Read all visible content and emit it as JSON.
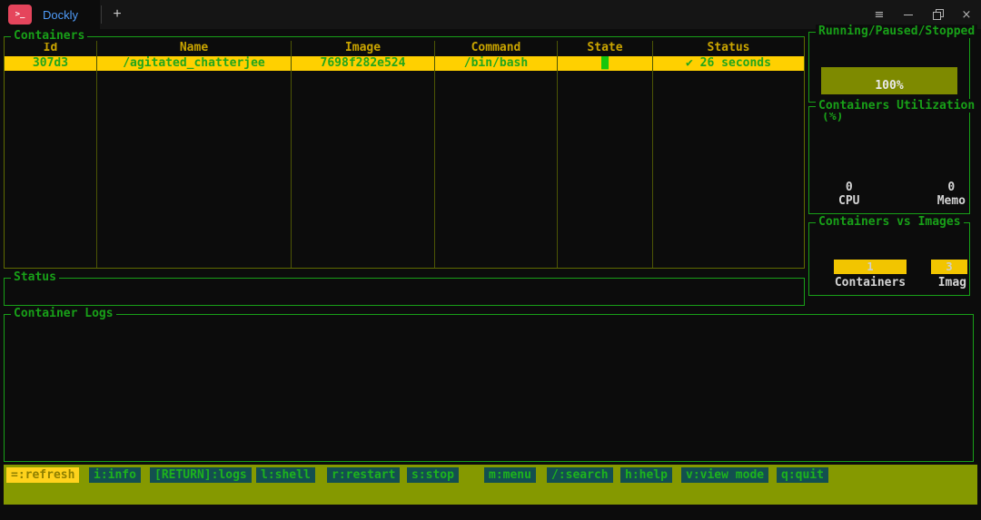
{
  "window": {
    "tab_title": "Dockly",
    "terminal_icon_glyph": ">_",
    "new_tab_glyph": "+",
    "controls": {
      "menu_glyph": "≡",
      "close_glyph": "×"
    }
  },
  "containers_panel": {
    "title": "Containers",
    "columns": [
      "Id",
      "Name",
      "Image",
      "Command",
      "State",
      "Status"
    ],
    "rows": [
      {
        "id": "307d3",
        "name": "/agitated_chatterjee",
        "image": "7698f282e524",
        "command": "/bin/bash",
        "state_glyph": "█",
        "status": "✔ 26 seconds",
        "selected": true
      }
    ]
  },
  "status_panel": {
    "title": "Status",
    "content": ""
  },
  "logs_panel": {
    "title": "Container Logs",
    "content": ""
  },
  "gauge_panel": {
    "title": "Running/Paused/Stopped",
    "percent": 100,
    "percent_label": "100%"
  },
  "utilization_panel": {
    "title_line1": "Containers Utilization",
    "title_line2": "(%)",
    "cpu_value": "0",
    "cpu_label": "CPU",
    "memory_value": "0",
    "memory_label": "Memo"
  },
  "comparison_panel": {
    "title": "Containers vs Images",
    "bars": [
      {
        "value": "1",
        "label": "Containers"
      },
      {
        "value": "3",
        "label": "Imag"
      }
    ]
  },
  "toolbar": {
    "items": [
      {
        "label": "=:refresh",
        "active": true
      },
      {
        "label": "i:info"
      },
      {
        "label": "[RETURN]:logs"
      },
      {
        "label": "l:shell"
      },
      {
        "label": "r:restart"
      },
      {
        "label": "s:stop"
      },
      {
        "label": "m:menu"
      },
      {
        "label": "/:search"
      },
      {
        "label": "h:help"
      },
      {
        "label": "v:view mode"
      },
      {
        "label": "q:quit"
      }
    ]
  },
  "colors": {
    "border_green": "#18a018",
    "table_border_olive": "#4d5505",
    "selection_yellow": "#ffd000",
    "selection_text_green": "#21a61c",
    "state_green": "#16c60c",
    "gauge_olive": "#7e8a00",
    "toolbar_olive": "#859900",
    "toolbar_button_teal": "#134f4f",
    "tab_title_blue": "#4f9bf8",
    "terminal_icon_red": "#e5455c",
    "header_yellow": "#c9a400"
  }
}
